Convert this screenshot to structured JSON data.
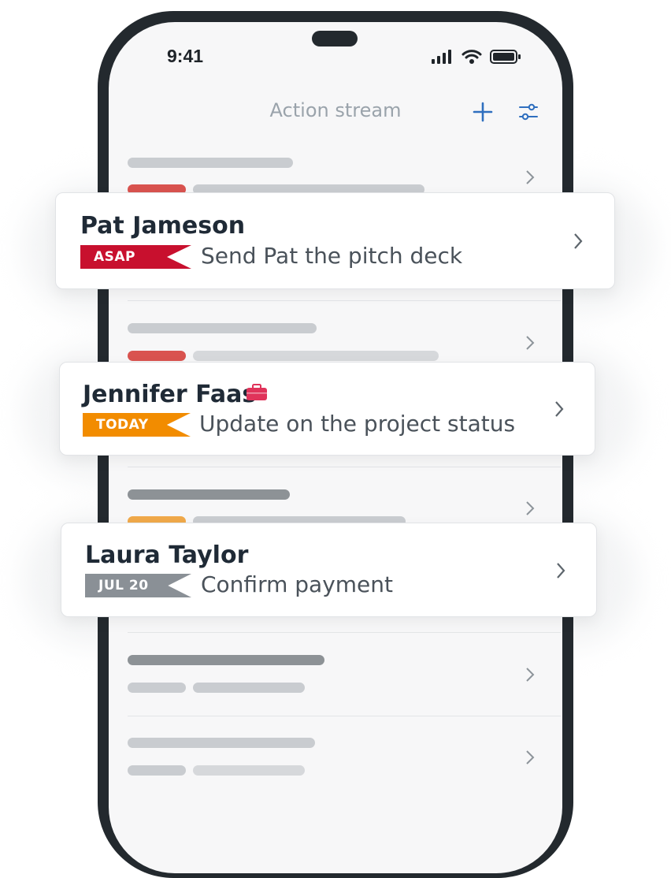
{
  "status_bar": {
    "time": "9:41"
  },
  "header": {
    "title": "Action stream",
    "add_icon": "plus-icon",
    "filter_icon": "sliders-icon"
  },
  "colors": {
    "accent": "#2f6fbf",
    "asap": "#c8102e",
    "today": "#f28c00",
    "date": "#8a9096",
    "briefcase": "#e0335a"
  },
  "cards": [
    {
      "name": "Pat Jameson",
      "tag": "ASAP",
      "task": "Send Pat the pitch deck"
    },
    {
      "name": "Jennifer Faas",
      "tag": "TODAY",
      "task": "Update on the project status",
      "icon": "briefcase-icon"
    },
    {
      "name": "Laura Taylor",
      "tag": "JUL 20",
      "task": "Confirm payment"
    }
  ]
}
